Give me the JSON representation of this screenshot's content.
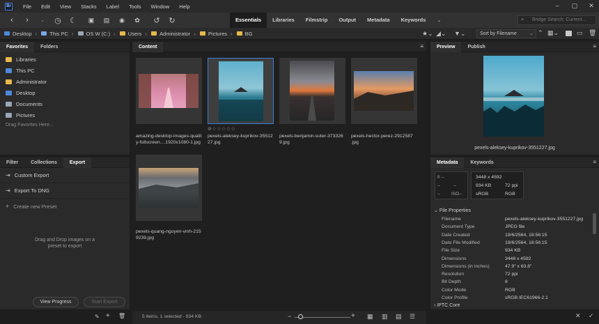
{
  "menu": {
    "logo": "Br",
    "items": [
      "File",
      "Edit",
      "View",
      "Stacks",
      "Label",
      "Tools",
      "Window",
      "Help"
    ]
  },
  "toolbar": {
    "workspaces": [
      "Essentials",
      "Libraries",
      "Filmstrip",
      "Output",
      "Metadata",
      "Keywords"
    ],
    "active_workspace": "Essentials",
    "search_placeholder": "Bridge Search: Current..."
  },
  "breadcrumb": [
    "Desktop",
    "This PC",
    "OS W (C:)",
    "Users",
    "Administrator",
    "Pictures",
    "BG"
  ],
  "sort": {
    "label": "Sort by Filename"
  },
  "left_top": {
    "tabs": [
      "Favorites",
      "Folders"
    ],
    "favorites": [
      {
        "label": "Libraries",
        "color": "#e6b94c"
      },
      {
        "label": "This PC",
        "color": "#4f87d8"
      },
      {
        "label": "Administrator",
        "color": "#e6b94c"
      },
      {
        "label": "Desktop",
        "color": "#4f87d8"
      },
      {
        "label": "Documents",
        "color": "#9aa6b6"
      },
      {
        "label": "Pictures",
        "color": "#9aa6b6"
      }
    ],
    "hint": "Drag Favorites Here..."
  },
  "left_bottom": {
    "tabs": [
      "Filter",
      "Collections",
      "Export"
    ],
    "items": [
      "Custom Export",
      "Export To DNG"
    ],
    "create": "Create new Preset",
    "drop_hint_1": "Drag and Drop images on a",
    "drop_hint_2": "preset to export",
    "view_progress": "View Progress",
    "start_export": "Start Export"
  },
  "content": {
    "tab": "Content",
    "items": [
      {
        "cap1": "amazing-desktop-images-qualit",
        "cap2": "y-fullscreen....1920x1080-1.jpg"
      },
      {
        "cap1": "pexels-aleksey-kuprikov-35512",
        "cap2": "27.jpg"
      },
      {
        "cap1": "pexels-benjamin-suter-373326",
        "cap2": "9.jpg"
      },
      {
        "cap1": "pexels-hector-perez-2912587",
        "cap2": ".jpg"
      },
      {
        "cap1": "pexels-quang-nguyen-vinh-215",
        "cap2": "9239.jpg"
      }
    ],
    "rating": "☆☆☆☆☆",
    "status": "5 items, 1 selected - 934 KB"
  },
  "preview": {
    "tabs": [
      "Preview",
      "Publish"
    ],
    "filename": "pexels-aleksey-kuprikov-3551227.jpg"
  },
  "metadata": {
    "tabs": [
      "Metadata",
      "Keywords"
    ],
    "camera": {
      "f": "f/ --",
      "dash1": "--",
      "dash2": "--",
      "dash3": "--",
      "iso": "ISO--"
    },
    "summary": {
      "dims": "3448 x 4592",
      "size": "934 KB",
      "ppi": "72 ppi",
      "space": "sRGB",
      "mode": "RGB"
    },
    "section": "File Properties",
    "rows": [
      {
        "k": "Filename",
        "v": "pexels-aleksey-kuprikov-3551227.jpg"
      },
      {
        "k": "Document Type",
        "v": "JPEG file"
      },
      {
        "k": "Date Created",
        "v": "19/6/2564, 18:56:15"
      },
      {
        "k": "Date File Modified",
        "v": "19/6/2564, 18:56:15"
      },
      {
        "k": "File Size",
        "v": "934 KB"
      },
      {
        "k": "Dimensions",
        "v": "3448 x 4592"
      },
      {
        "k": "Dimensions (in inches)",
        "v": "47.9\" x 63.8\""
      },
      {
        "k": "Resolution",
        "v": "72 ppi"
      },
      {
        "k": "Bit Depth",
        "v": "8"
      },
      {
        "k": "Color Mode",
        "v": "RGB"
      },
      {
        "k": "Color Profile",
        "v": "sRGB IEC61966-2.1"
      }
    ],
    "section2": "IPTC Core"
  }
}
